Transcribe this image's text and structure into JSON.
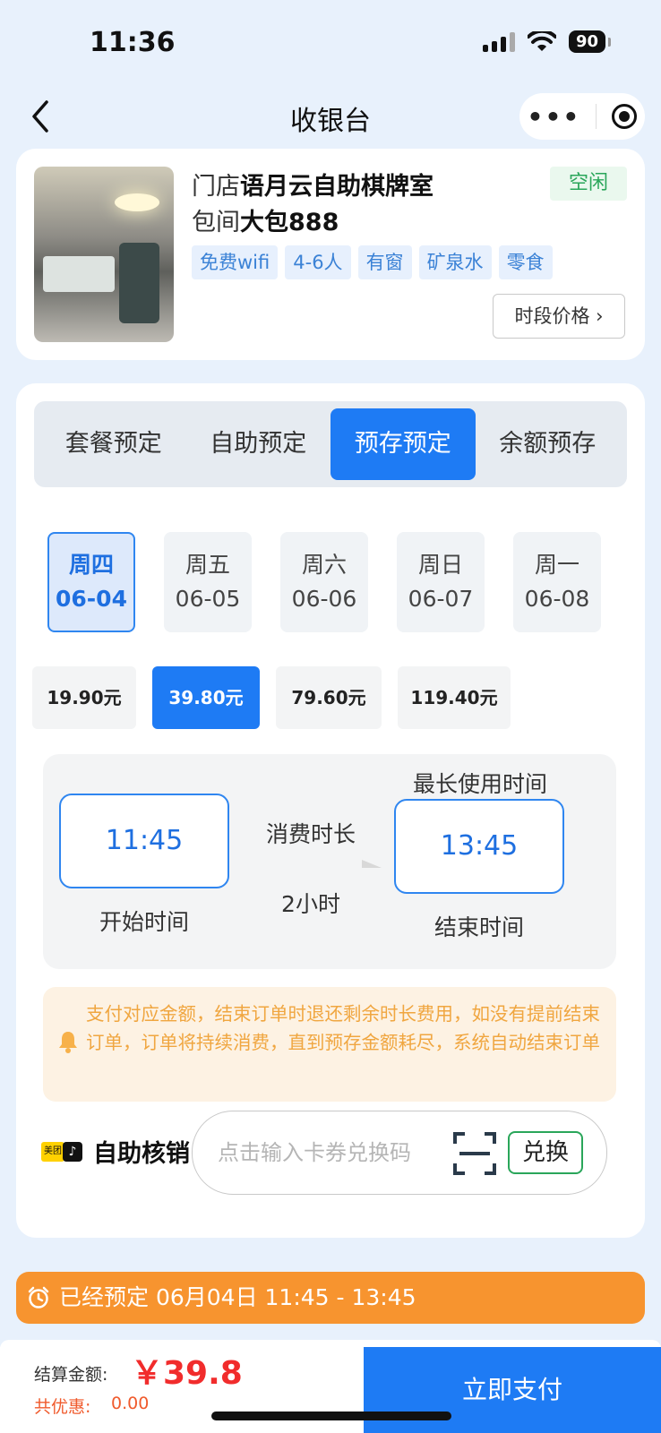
{
  "status_bar": {
    "time": "11:36",
    "battery": "90"
  },
  "nav": {
    "title": "收银台"
  },
  "store": {
    "store_prefix": "门店",
    "store_name": "语月云自助棋牌室",
    "room_prefix": "包间",
    "room_name": "大包888",
    "status": "空闲",
    "tags": [
      "免费wifi",
      "4-6人",
      "有窗",
      "矿泉水",
      "零食"
    ],
    "price_button": "时段价格 ›"
  },
  "booking_tabs": [
    {
      "label": "套餐预定",
      "active": false
    },
    {
      "label": "自助预定",
      "active": false
    },
    {
      "label": "预存预定",
      "active": true
    },
    {
      "label": "余额预存",
      "active": false
    }
  ],
  "days": [
    {
      "weekday": "周四",
      "date": "06-04",
      "active": true
    },
    {
      "weekday": "周五",
      "date": "06-05",
      "active": false
    },
    {
      "weekday": "周六",
      "date": "06-06",
      "active": false
    },
    {
      "weekday": "周日",
      "date": "06-07",
      "active": false
    },
    {
      "weekday": "周一",
      "date": "06-08",
      "active": false
    }
  ],
  "amounts": [
    {
      "label": "19.90元",
      "active": false
    },
    {
      "label": "39.80元",
      "active": true
    },
    {
      "label": "79.60元",
      "active": false
    },
    {
      "label": "119.40元",
      "active": false
    }
  ],
  "time": {
    "start_time": "11:45",
    "start_label": "开始时间",
    "duration_label": "消费时长",
    "duration_value": "2小时",
    "max_label": "最长使用时间",
    "end_time": "13:45",
    "end_label": "结束时间"
  },
  "notice": "支付对应金额，结束订单时退还剩余时长费用，如没有提前结束订单，订单将持续消费，直到预存金额耗尽，系统自动结束订单",
  "verify": {
    "meituan_badge": "美团",
    "label": "自助核销",
    "placeholder": "点击输入卡券兑换码",
    "redeem_button": "兑换"
  },
  "booked_bar": "已经预定 06月04日 11:45 - 13:45",
  "footer": {
    "total_label": "结算金额:",
    "total_value": "￥39.8",
    "discount_label": "共优惠:",
    "discount_value": "0.00",
    "pay_button": "立即支付"
  },
  "colors": {
    "primary": "#1e7bf4",
    "orange": "#f7942f",
    "price_red": "#f12c2c",
    "idle_green": "#2aa65a"
  }
}
